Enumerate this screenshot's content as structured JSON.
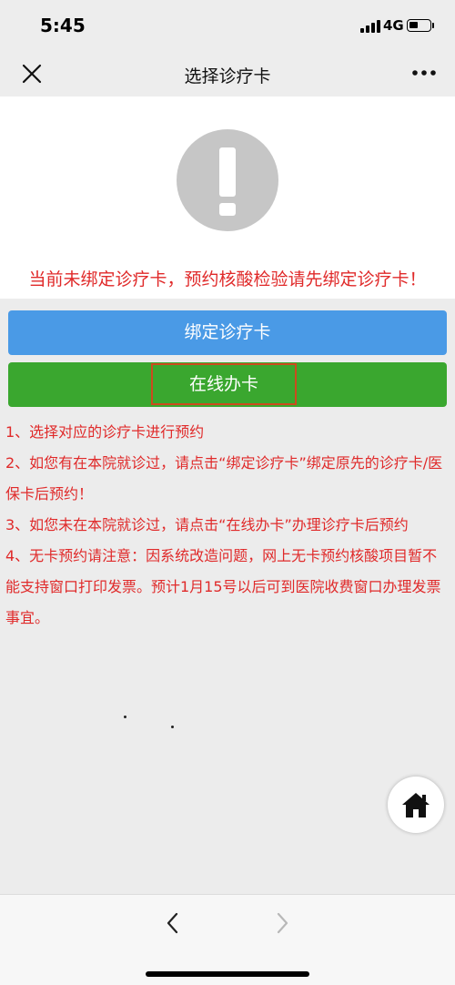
{
  "status_bar": {
    "time": "5:45",
    "network": "4G"
  },
  "nav": {
    "title": "选择诊疗卡",
    "close_icon": "close-icon",
    "more_icon": "more-icon"
  },
  "alert": {
    "icon": "exclamation-icon",
    "message": "当前未绑定诊疗卡，预约核酸检验请先绑定诊疗卡！"
  },
  "buttons": {
    "bind_card": "绑定诊疗卡",
    "online_card": "在线办卡"
  },
  "notes": [
    "1、选择对应的诊疗卡进行预约",
    "2、如您有在本院就诊过，请点击“绑定诊疗卡”绑定原先的诊疗卡/医保卡后预约！",
    "3、如您未在本院就诊过，请点击“在线办卡”办理诊疗卡后预约",
    "4、无卡预约请注意：因系统改造问题，网上无卡预约核酸项目暂不能支持窗口打印发票。预计1月15号以后可到医院收费窗口办理发票事宜。"
  ],
  "colors": {
    "alert_text": "#e02a2a",
    "bind_button": "#4a9ae6",
    "online_button": "#3aa72f",
    "highlight_border": "#cc4a1e"
  },
  "floating": {
    "home_icon": "home-icon"
  },
  "toolbar": {
    "back_icon": "chevron-left-icon",
    "forward_icon": "chevron-right-icon"
  }
}
